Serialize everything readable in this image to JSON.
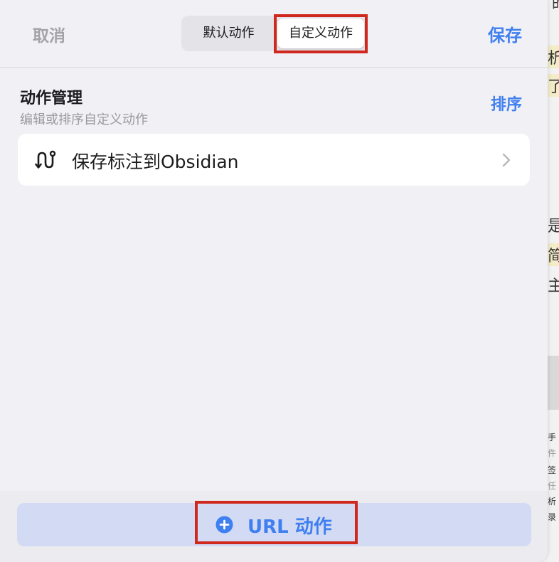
{
  "header": {
    "cancel_label": "取消",
    "save_label": "保存",
    "tabs": [
      {
        "label": "默认动作",
        "selected": false
      },
      {
        "label": "自定义动作",
        "selected": true
      }
    ]
  },
  "section": {
    "title": "动作管理",
    "subtitle": "编辑或排序自定义动作",
    "sort_label": "排序"
  },
  "actions": [
    {
      "label": "保存标注到Obsidian",
      "icon": "route-icon"
    }
  ],
  "footer": {
    "add_button_label": "URL 动作",
    "add_button_icon": "plus-circle-icon"
  },
  "background_doc": {
    "fragments": [
      "的",
      "析",
      "了",
      "是一",
      "简",
      "主",
      "手",
      "件",
      "签",
      "任",
      "析",
      "录"
    ]
  },
  "colors": {
    "accent": "#3f7ff0",
    "highlight_box": "#d0281c",
    "sheet_bg": "#f0f0f5",
    "add_button_bg": "#d3dbf4"
  }
}
